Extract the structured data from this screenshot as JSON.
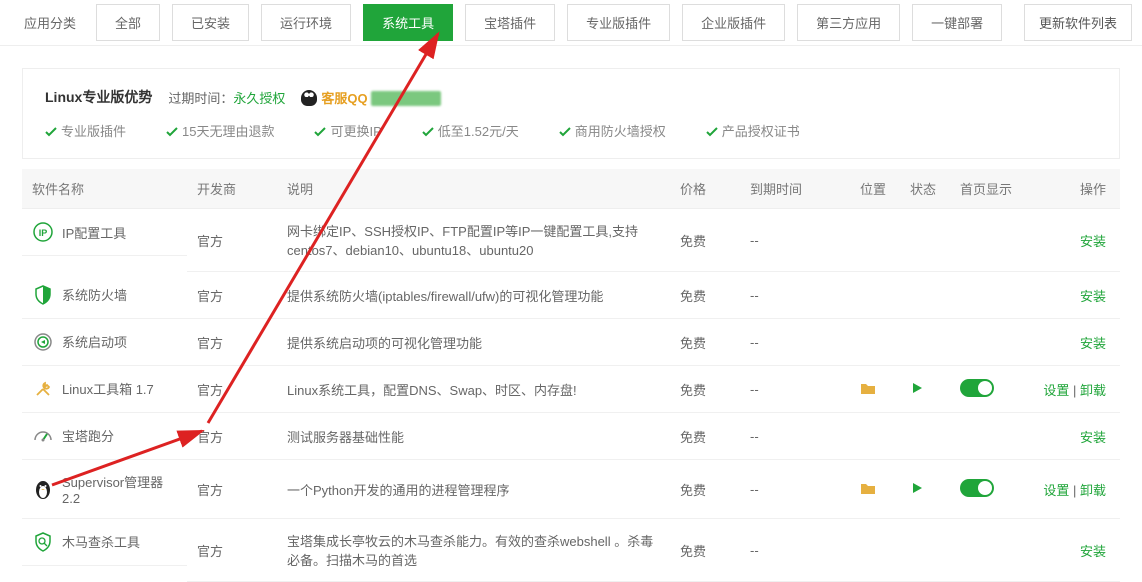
{
  "tabs": {
    "label": "应用分类",
    "items": [
      "全部",
      "已安装",
      "运行环境",
      "系统工具",
      "宝塔插件",
      "专业版插件",
      "企业版插件",
      "第三方应用",
      "一键部署"
    ],
    "active_index": 3,
    "update_btn": "更新软件列表"
  },
  "promo": {
    "title": "Linux专业版优势",
    "expire_label": "过期时间：",
    "expire_value": "永久授权",
    "qq_label": "客服QQ",
    "features": [
      "专业版插件",
      "15天无理由退款",
      "可更换IP",
      "低至1.52元/天",
      "商用防火墙授权",
      "产品授权证书"
    ]
  },
  "columns": {
    "name": "软件名称",
    "dev": "开发商",
    "desc": "说明",
    "price": "价格",
    "expire": "到期时间",
    "pos": "位置",
    "status": "状态",
    "home": "首页显示",
    "op": "操作"
  },
  "labels": {
    "install": "安装",
    "settings": "设置",
    "uninstall": "卸载",
    "sep": " | "
  },
  "rows": [
    {
      "icon": "ip",
      "name": "IP配置工具",
      "dev": "官方",
      "desc": "网卡绑定IP、SSH授权IP、FTP配置IP等IP一键配置工具,支持centos7、debian10、ubuntu18、ubuntu20",
      "price": "免费",
      "expire": "--",
      "installed": false
    },
    {
      "icon": "shield",
      "name": "系统防火墙",
      "dev": "官方",
      "desc": "提供系统防火墙(iptables/firewall/ufw)的可视化管理功能",
      "price": "免费",
      "expire": "--",
      "installed": false
    },
    {
      "icon": "power",
      "name": "系统启动项",
      "dev": "官方",
      "desc": "提供系统启动项的可视化管理功能",
      "price": "免费",
      "expire": "--",
      "installed": false
    },
    {
      "icon": "tools",
      "name": "Linux工具箱 1.7",
      "dev": "官方",
      "desc": "Linux系统工具，配置DNS、Swap、时区、内存盘!",
      "price": "免费",
      "expire": "--",
      "installed": true
    },
    {
      "icon": "gauge",
      "name": "宝塔跑分",
      "dev": "官方",
      "desc": "测试服务器基础性能",
      "price": "免费",
      "expire": "--",
      "installed": false
    },
    {
      "icon": "penguin",
      "name": "Supervisor管理器 2.2",
      "dev": "官方",
      "desc": "一个Python开发的通用的进程管理程序",
      "price": "免费",
      "expire": "--",
      "installed": true
    },
    {
      "icon": "scan",
      "name": "木马查杀工具",
      "dev": "官方",
      "desc": "宝塔集成长亭牧云的木马查杀能力。有效的查杀webshell 。杀毒必备。扫描木马的首选",
      "price": "免费",
      "expire": "--",
      "installed": false
    }
  ]
}
